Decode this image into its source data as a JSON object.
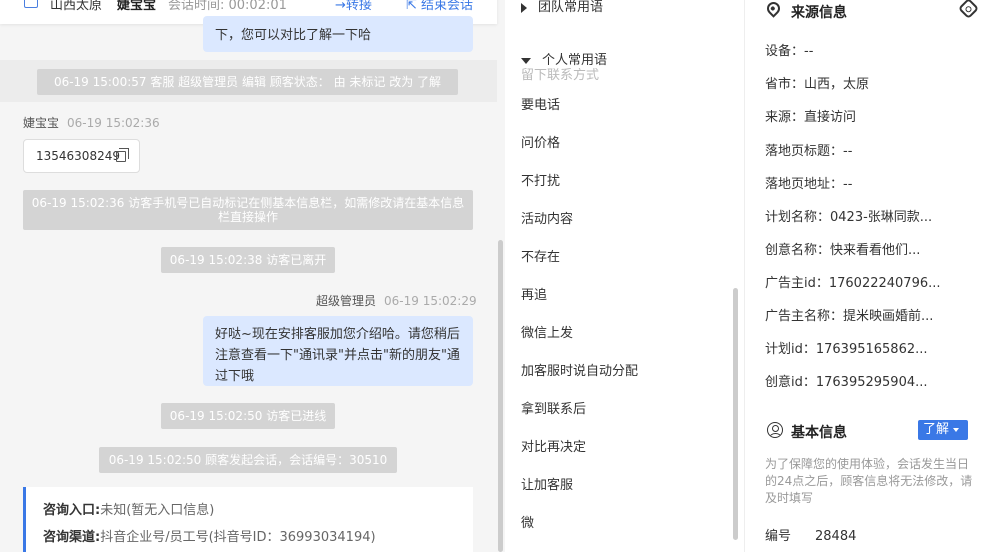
{
  "header": {
    "location": "山西太原",
    "visitor_name": "婕宝宝",
    "session_time": "会话时间: 00:02:01",
    "transfer": "→转接",
    "end_session": "⇱ 结束会话"
  },
  "chat": {
    "top_bubble_tail": "下，您可以对比了解一下哈",
    "sys1": "06-19 15:00:57 客服 超级管理员 编辑 顾客状态： 由 未标记 改为 了解",
    "visitor_sender": "婕宝宝",
    "visitor_time": "06-19 15:02:36",
    "phone": "13546308249",
    "sys2": "06-19 15:02:36 访客手机号已自动标记在侧基本信息栏，如需修改请在基本信息栏直接操作",
    "sys3": "06-19 15:02:38 访客已离开",
    "agent_sender": "超级管理员",
    "agent_time": "06-19 15:02:29",
    "agent_msg": "好哒~现在安排客服加您介绍哈。请您稍后注意查看一下\"通讯录\"并点击\"新的朋友\"通过下哦",
    "sys4": "06-19 15:02:50 访客已进线",
    "sys5": "06-19 15:02:50 顾客发起会话，会话编号：30510",
    "entry_label": "咨询入口:",
    "entry_value": "未知(暂无入口信息)",
    "channel_label": "咨询渠道:",
    "channel_value": "抖音企业号/员工号(抖音号ID：36993034194)"
  },
  "phrases": {
    "team_group": "团队常用语",
    "personal_group": "个人常用语",
    "ghost_item": "留下联系方式",
    "items": [
      "要电话",
      "问价格",
      "不打扰",
      "活动内容",
      "不存在",
      "再追",
      "微信上发",
      "加客服时说自动分配",
      "拿到联系后",
      "对比再决定",
      "让加客服",
      "微"
    ]
  },
  "info": {
    "source_title": "来源信息",
    "rows": [
      "设备：--",
      "省市：山西，太原",
      "来源：直接访问",
      "落地页标题：--",
      "落地页地址：--",
      "计划名称：0423-张琳同款...",
      "创意名称：快来看看他们...",
      "广告主id：176022240796...",
      "广告主名称：提米映画婚前...",
      "计划id：176395165862...",
      "创意id：176395295904..."
    ],
    "basic_title": "基本信息",
    "learn_button": "了解",
    "notice": "为了保障您的使用体验，会话发生当日的24点之后，顾客信息将无法修改，请及时填写",
    "id_label": "编号",
    "id_value": "28484"
  },
  "colors": {
    "accent": "#3a78e6",
    "agent_bubble": "#dbe8ff",
    "system_msg": "#d4d4d4"
  }
}
